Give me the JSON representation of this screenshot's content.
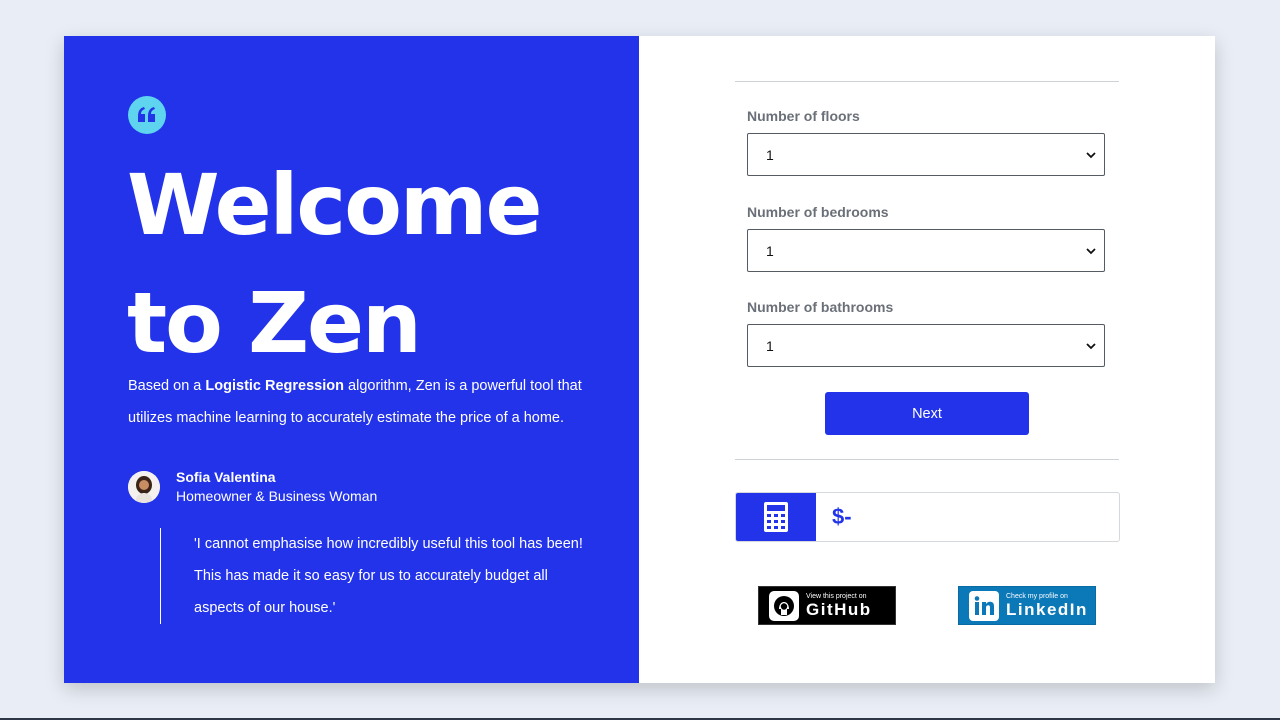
{
  "hero": {
    "headline_line1": "Welcome",
    "headline_line2": "to Zen",
    "intro_prefix": "Based on a ",
    "intro_bold": "Logistic Regression",
    "intro_suffix": " algorithm, Zen is a powerful tool that utilizes machine learning to accurately estimate the price of a home.",
    "author_name": "Sofia Valentina",
    "author_role": "Homeowner & Business Woman",
    "testimonial": "'I cannot emphasise how incredibly useful this tool has been! This has made it so easy for us to accurately budget all aspects of our house.'"
  },
  "form": {
    "floors_label": "Number of floors",
    "floors_value": "1",
    "bedrooms_label": "Number of bedrooms",
    "bedrooms_value": "1",
    "bathrooms_label": "Number of bathrooms",
    "bathrooms_value": "1",
    "next_label": "Next"
  },
  "result": {
    "value": "$-"
  },
  "links": {
    "github_small": "View this project on",
    "github_big": "GitHub",
    "linkedin_small": "Check my profile on",
    "linkedin_big": "LinkedIn"
  },
  "icons": {
    "quote": "quote-icon",
    "calculator": "calculator-icon",
    "github": "github-icon",
    "linkedin": "linkedin-icon"
  },
  "colors": {
    "brand_blue": "#2233ea",
    "quote_badge": "#5fd4ee",
    "linkedin": "#0b78b8"
  }
}
